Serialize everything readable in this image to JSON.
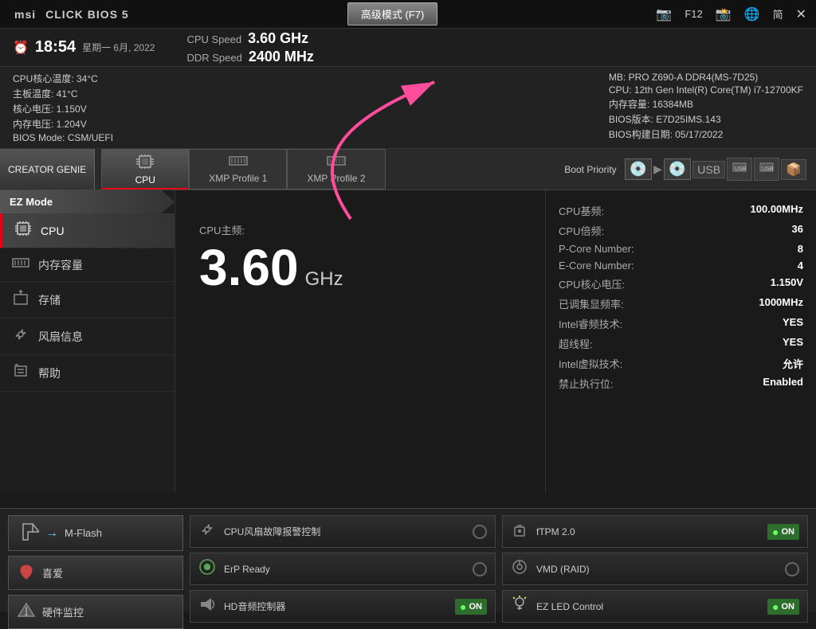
{
  "topbar": {
    "logo": "msi",
    "product": "CLICK BIOS 5",
    "advanced_btn": "高级模式 (F7)",
    "f12_btn": "F12",
    "close_icon": "✕",
    "screenshot_icon": "📷",
    "globe_icon": "🌐",
    "lang": "简"
  },
  "statusbar": {
    "clock_icon": "⏰",
    "time": "18:54",
    "weekday": "星期一 6月, 2022",
    "cpu_speed_label": "CPU Speed",
    "cpu_speed_value": "3.60 GHz",
    "ddr_speed_label": "DDR Speed",
    "ddr_speed_value": "2400 MHz"
  },
  "infobar": {
    "left": [
      "CPU核心温度: 34°C",
      "主板温度: 41°C",
      "核心电压: 1.150V",
      "内存电压: 1.204V",
      "BIOS Mode: CSM/UEFI"
    ],
    "right": [
      "MB: PRO Z690-A DDR4(MS-7D25)",
      "CPU: 12th Gen Intel(R) Core(TM) i7-12700KF",
      "内存容量: 16384MB",
      "BIOS版本: E7D25IMS.143",
      "BIOS构建日期: 05/17/2022"
    ]
  },
  "creator": {
    "label": "CREATOR GENIE",
    "tabs": [
      {
        "id": "cpu",
        "label": "CPU",
        "icon": "⬛",
        "active": true
      },
      {
        "id": "xmp1",
        "label": "XMP Profile 1",
        "icon": "▦",
        "active": false
      },
      {
        "id": "xmp2",
        "label": "XMP Profile 2",
        "icon": "▦",
        "active": false
      }
    ]
  },
  "boot_priority": {
    "label": "Boot Priority",
    "devices": [
      "💿",
      "💿",
      "🔌",
      "🔌",
      "🔌",
      "🔌",
      "📦"
    ]
  },
  "sidebar": {
    "ez_mode": "EZ Mode",
    "items": [
      {
        "id": "cpu",
        "label": "CPU",
        "icon": "⬛",
        "active": true
      },
      {
        "id": "memory",
        "label": "内存容量",
        "icon": "▦"
      },
      {
        "id": "storage",
        "label": "存储",
        "icon": "⬆"
      },
      {
        "id": "fan",
        "label": "风扇信息",
        "icon": "✦"
      },
      {
        "id": "help",
        "label": "帮助",
        "icon": "🔑"
      }
    ]
  },
  "cpu_panel": {
    "speed_label": "CPU主频:",
    "speed_value": "3.60",
    "speed_unit": "GHz"
  },
  "cpu_specs": [
    {
      "label": "CPU基频:",
      "value": "100.00MHz"
    },
    {
      "label": "CPU倍频:",
      "value": "36"
    },
    {
      "label": "P-Core Number:",
      "value": "8"
    },
    {
      "label": "E-Core Number:",
      "value": "4"
    },
    {
      "label": "CPU核心电压:",
      "value": "1.150V"
    },
    {
      "label": "已调集显频率:",
      "value": "1000MHz"
    },
    {
      "label": "Intel睿频技术:",
      "value": "YES"
    },
    {
      "label": "超线程:",
      "value": "YES"
    },
    {
      "label": "Intel虚拟技术:",
      "value": "允许"
    },
    {
      "label": "禁止执行位:",
      "value": "Enabled"
    }
  ],
  "bottom": {
    "left_buttons": [
      {
        "id": "mflash",
        "label": "M-Flash",
        "icon": "⚡"
      },
      {
        "id": "favorites",
        "label": "喜爱",
        "icon": "❤"
      },
      {
        "id": "monitor",
        "label": "硬件监控",
        "icon": "⚙"
      }
    ],
    "middle_features": [
      {
        "id": "cpu-fan",
        "label": "CPU风扇故障报警控制",
        "icon": "⚙",
        "toggle": "radio"
      },
      {
        "id": "erp",
        "label": "ErP Ready",
        "icon": "🌿",
        "toggle": "radio"
      },
      {
        "id": "hd-audio",
        "label": "HD音频控制器",
        "icon": "🔊",
        "toggle": "on"
      }
    ],
    "right_features": [
      {
        "id": "ftpm",
        "label": "fTPM 2.0",
        "icon": "🔒",
        "toggle": "on"
      },
      {
        "id": "vmd",
        "label": "VMD (RAID)",
        "icon": "💾",
        "toggle": "radio"
      },
      {
        "id": "ez-led",
        "label": "EZ LED Control",
        "icon": "💡",
        "toggle": "on"
      }
    ]
  }
}
